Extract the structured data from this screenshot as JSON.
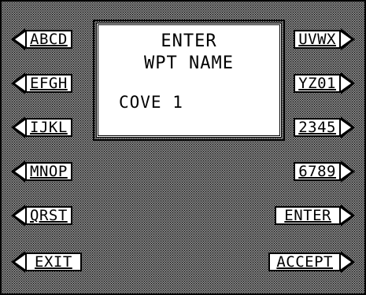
{
  "dialog": {
    "title_line1": "ENTER",
    "title_line2": "WPT NAME",
    "name_value": "COVE 1"
  },
  "left_keys": [
    "ABCD",
    "EFGH",
    "IJKL",
    "MNOP",
    "QRST",
    "EXIT"
  ],
  "right_keys": [
    "UVWX",
    "YZ01",
    "2345",
    "6789",
    "ENTER",
    "ACCEPT"
  ]
}
